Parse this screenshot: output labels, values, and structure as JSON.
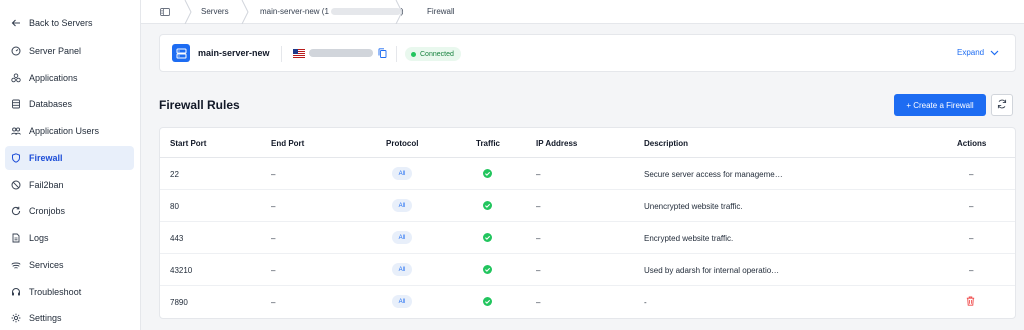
{
  "sidebar": {
    "items": [
      {
        "label": "Back to Servers",
        "icon": "arrow-left-icon"
      },
      {
        "label": "Server Panel",
        "icon": "gauge-icon"
      },
      {
        "label": "Applications",
        "icon": "apps-icon"
      },
      {
        "label": "Databases",
        "icon": "database-icon"
      },
      {
        "label": "Application Users",
        "icon": "users-icon"
      },
      {
        "label": "Firewall",
        "icon": "shield-icon",
        "active": true
      },
      {
        "label": "Fail2ban",
        "icon": "ban-icon"
      },
      {
        "label": "Cronjobs",
        "icon": "refresh-icon"
      },
      {
        "label": "Logs",
        "icon": "file-icon"
      },
      {
        "label": "Services",
        "icon": "services-icon"
      },
      {
        "label": "Troubleshoot",
        "icon": "headset-icon"
      },
      {
        "label": "Settings",
        "icon": "gear-icon"
      }
    ]
  },
  "breadcrumb": {
    "items": [
      "Servers",
      "main-server-new (1",
      "Firewall"
    ],
    "server_suffix": ")"
  },
  "server": {
    "name": "main-server-new",
    "status": "Connected",
    "expand_label": "Expand"
  },
  "page": {
    "title": "Firewall Rules",
    "create_button": "+ Create a Firewall"
  },
  "table": {
    "headers": [
      "Start Port",
      "End Port",
      "Protocol",
      "Traffic",
      "IP Address",
      "Description",
      "Actions"
    ],
    "rows": [
      {
        "start": "22",
        "end": "–",
        "protocol": "All",
        "ip": "–",
        "description": "Secure server access for manageme…",
        "action": "–"
      },
      {
        "start": "80",
        "end": "–",
        "protocol": "All",
        "ip": "–",
        "description": "Unencrypted website traffic.",
        "action": "–"
      },
      {
        "start": "443",
        "end": "–",
        "protocol": "All",
        "ip": "–",
        "description": "Encrypted website traffic.",
        "action": "–"
      },
      {
        "start": "43210",
        "end": "–",
        "protocol": "All",
        "ip": "–",
        "description": "Used by adarsh for internal operatio…",
        "action": "–"
      },
      {
        "start": "7890",
        "end": "–",
        "protocol": "All",
        "ip": "–",
        "description": "-",
        "action": "delete"
      }
    ]
  },
  "colors": {
    "accent": "#1d6cf2",
    "success": "#22c55e",
    "danger": "#ef4444"
  }
}
